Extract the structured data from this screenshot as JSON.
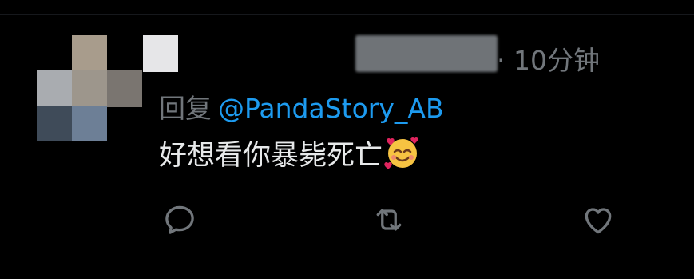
{
  "tweet": {
    "timestamp_sep": "·",
    "timestamp": "10分钟",
    "reply_prefix": "回复",
    "reply_to": "@PandaStory_AB",
    "text": "好想看你暴毙死亡"
  },
  "icons": {
    "emoji": "smiling-face-with-hearts-emoji",
    "reply": "reply-icon",
    "retweet": "retweet-icon",
    "like": "like-icon"
  },
  "colors": {
    "background": "#000000",
    "muted_text": "#71767b",
    "body_text": "#e7e9ea",
    "mention": "#1d9bf0"
  }
}
